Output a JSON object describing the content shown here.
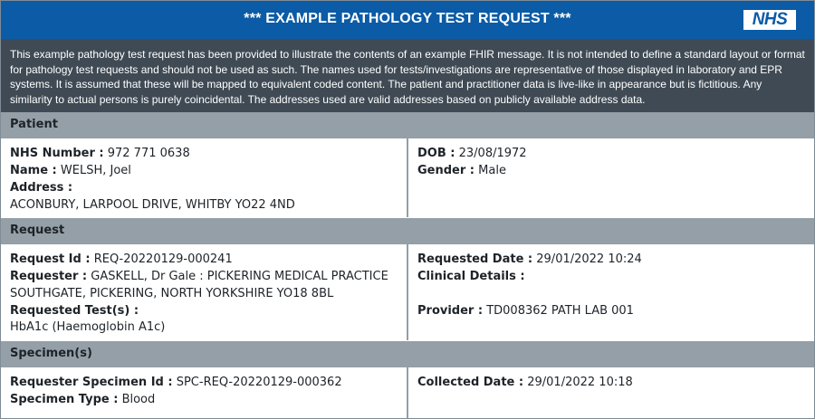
{
  "header": {
    "title": "*** EXAMPLE PATHOLOGY TEST REQUEST ***",
    "logo_text": "NHS"
  },
  "disclaimer": "This example pathology test request has been provided to illustrate the contents of an example FHIR message. It is not intended to define a standard layout or format for pathology test requests and should not be used as such. The names used for tests/investigations are representative of those displayed in laboratory and EPR systems. It is assumed that these will be mapped to equivalent coded content. The patient and practitioner data is live-like in appearance but is fictitious. Any similarity to actual persons is purely coincidental. The addresses used are valid addresses based on publicly available address data.",
  "patient": {
    "section_title": "Patient",
    "nhs_number_label": "NHS Number :",
    "nhs_number": "972 771 0638",
    "name_label": "Name :",
    "name": "WELSH, Joel",
    "address_label": "Address :",
    "address": "ACONBURY, LARPOOL DRIVE, WHITBY YO22 4ND",
    "dob_label": "DOB :",
    "dob": "23/08/1972",
    "gender_label": "Gender :",
    "gender": "Male"
  },
  "request": {
    "section_title": "Request",
    "request_id_label": "Request Id :",
    "request_id": "REQ-20220129-000241",
    "requester_label": "Requester :",
    "requester": "GASKELL, Dr Gale : PICKERING MEDICAL PRACTICE",
    "requester_address": "SOUTHGATE, PICKERING, NORTH YORKSHIRE YO18 8BL",
    "requested_tests_label": "Requested Test(s) :",
    "requested_tests": "HbA1c (Haemoglobin A1c)",
    "requested_date_label": "Requested Date :",
    "requested_date": "29/01/2022 10:24",
    "clinical_details_label": "Clinical Details :",
    "provider_label": "Provider :",
    "provider": "TD008362 PATH LAB 001"
  },
  "specimen": {
    "section_title": "Specimen(s)",
    "specimen_id_label": "Requester Specimen Id :",
    "specimen_id": "SPC-REQ-20220129-000362",
    "specimen_type_label": "Specimen Type :",
    "specimen_type": "Blood",
    "collected_date_label": "Collected Date :",
    "collected_date": "29/01/2022 10:18"
  }
}
